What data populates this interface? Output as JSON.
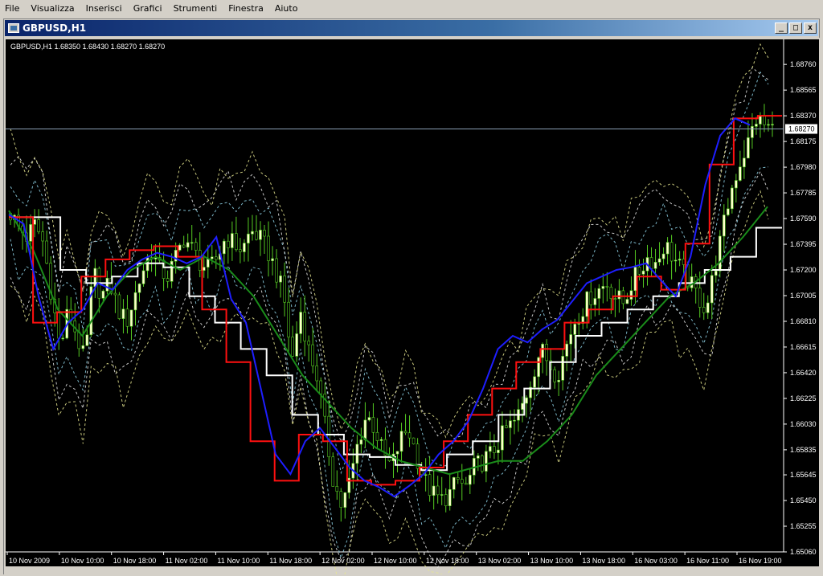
{
  "menu": {
    "items": [
      {
        "label": "File",
        "name": "menu-file"
      },
      {
        "label": "Visualizza",
        "name": "menu-visualizza"
      },
      {
        "label": "Inserisci",
        "name": "menu-inserisci"
      },
      {
        "label": "Grafici",
        "name": "menu-grafici"
      },
      {
        "label": "Strumenti",
        "name": "menu-strumenti"
      },
      {
        "label": "Finestra",
        "name": "menu-finestra"
      },
      {
        "label": "Aiuto",
        "name": "menu-aiuto"
      }
    ]
  },
  "window": {
    "title": "GBPUSD,H1",
    "buttons": {
      "minimize": "_",
      "maximize": "□",
      "close": "x"
    }
  },
  "chart_data": {
    "type": "candlestick",
    "info_text": "GBPUSD,H1  1.68350 1.68430 1.68270 1.68270",
    "price_tag": "1.68270",
    "ylim": [
      1.6506,
      1.6895
    ],
    "y_ticks": [
      "1.68760",
      "1.68565",
      "1.68370",
      "1.68175",
      "1.67980",
      "1.67785",
      "1.67590",
      "1.67395",
      "1.67200",
      "1.67005",
      "1.66810",
      "1.66615",
      "1.66420",
      "1.66225",
      "1.66030",
      "1.65835",
      "1.65645",
      "1.65450",
      "1.65255",
      "1.65060"
    ],
    "x_ticks": [
      "10 Nov 2009",
      "10 Nov 10:00",
      "10 Nov 18:00",
      "11 Nov 02:00",
      "11 Nov 10:00",
      "11 Nov 18:00",
      "12 Nov 02:00",
      "12 Nov 10:00",
      "12 Nov 18:00",
      "13 Nov 02:00",
      "13 Nov 10:00",
      "13 Nov 18:00",
      "16 Nov 03:00",
      "16 Nov 11:00",
      "16 Nov 19:00"
    ],
    "colors": {
      "background": "#000000",
      "bull_body": "#ffffcc",
      "bear_body": "#000000",
      "wick": "#55cc22",
      "blue_line": "#1e1eff",
      "red_line": "#ff1010",
      "green_line": "#1a8c1a",
      "white_line": "#ffffff",
      "band_cyan": "#8fd3e8",
      "band_white": "#e8e8e8",
      "band_yellow": "#e8e890",
      "grid_price_line": "#8a9fb5"
    },
    "close_path": [
      1.6763,
      1.6752,
      1.6745,
      1.6755,
      1.674,
      1.67,
      1.666,
      1.669,
      1.667,
      1.665,
      1.672,
      1.67,
      1.671,
      1.669,
      1.668,
      1.67,
      1.672,
      1.6735,
      1.672,
      1.6715,
      1.673,
      1.6745,
      1.6735,
      1.6725,
      1.672,
      1.673,
      1.6745,
      1.674,
      1.6735,
      1.675,
      1.6745,
      1.6735,
      1.672,
      1.67,
      1.665,
      1.669,
      1.666,
      1.664,
      1.66,
      1.656,
      1.654,
      1.656,
      1.659,
      1.661,
      1.66,
      1.658,
      1.657,
      1.659,
      1.66,
      1.658,
      1.656,
      1.655,
      1.6545,
      1.655,
      1.656,
      1.6555,
      1.657,
      1.6575,
      1.658,
      1.659,
      1.66,
      1.6605,
      1.662,
      1.664,
      1.666,
      1.665,
      1.664,
      1.666,
      1.668,
      1.669,
      1.67,
      1.6705,
      1.671,
      1.67,
      1.6695,
      1.671,
      1.672,
      1.673,
      1.6725,
      1.674,
      1.673,
      1.672,
      1.671,
      1.67,
      1.669,
      1.672,
      1.675,
      1.678,
      1.68,
      1.6815,
      1.6835,
      1.683,
      1.6827
    ],
    "blue_path": [
      1.6762,
      1.6755,
      1.67,
      1.666,
      1.668,
      1.669,
      1.671,
      1.6705,
      1.672,
      1.6728,
      1.6733,
      1.673,
      1.6725,
      1.673,
      1.6745,
      1.6698,
      1.668,
      1.663,
      1.658,
      1.6565,
      1.659,
      1.66,
      1.6585,
      1.657,
      1.656,
      1.6555,
      1.6548,
      1.6556,
      1.6565,
      1.658,
      1.659,
      1.6605,
      1.663,
      1.666,
      1.667,
      1.6665,
      1.6675,
      1.6682,
      1.6696,
      1.671,
      1.6715,
      1.672,
      1.6722,
      1.6725,
      1.6712,
      1.67,
      1.673,
      1.6785,
      1.6822,
      1.6835,
      1.683
    ],
    "red_path": [
      1.676,
      1.668,
      1.6688,
      1.6715,
      1.6728,
      1.6735,
      1.6738,
      1.673,
      1.669,
      1.665,
      1.659,
      1.656,
      1.6595,
      1.659,
      1.656,
      1.6557,
      1.656,
      1.657,
      1.659,
      1.661,
      1.663,
      1.665,
      1.666,
      1.668,
      1.669,
      1.67,
      1.6715,
      1.6705,
      1.674,
      1.68,
      1.6835,
      1.6837
    ],
    "green_path": [
      1.6765,
      1.6735,
      1.669,
      1.667,
      1.67,
      1.672,
      1.673,
      1.672,
      1.673,
      1.672,
      1.67,
      1.667,
      1.664,
      1.662,
      1.66,
      1.6585,
      1.6575,
      1.657,
      1.6565,
      1.657,
      1.6575,
      1.6575,
      1.659,
      1.661,
      1.664,
      1.666,
      1.668,
      1.67,
      1.671,
      1.6725,
      1.6745,
      1.6768
    ],
    "white_path": [
      1.676,
      1.676,
      1.672,
      1.671,
      1.6715,
      1.6725,
      1.6722,
      1.67,
      1.668,
      1.666,
      1.664,
      1.661,
      1.6595,
      1.658,
      1.6578,
      1.6572,
      1.6568,
      1.658,
      1.659,
      1.661,
      1.663,
      1.665,
      1.667,
      1.668,
      1.669,
      1.67,
      1.671,
      1.672,
      1.673,
      1.6752
    ]
  }
}
